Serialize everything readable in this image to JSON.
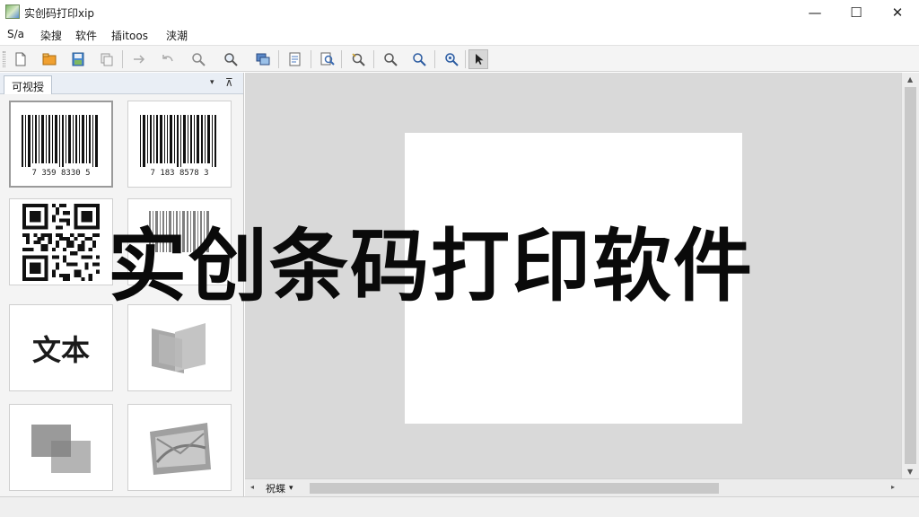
{
  "window": {
    "title": "实创码打印xip",
    "minimize_glyph": "—",
    "maximize_glyph": "☐",
    "close_glyph": "✕"
  },
  "menu": [
    "S/a",
    "染搜",
    "软件",
    "插itoos",
    "浃潮"
  ],
  "toolbar": {
    "buttons": [
      "new-file-icon",
      "open-folder-icon",
      "save-icon",
      "copy-icon",
      "redo-icon",
      "undo-icon",
      "find-icon",
      "zoom-icon",
      "layers-icon",
      "document-icon",
      "search-doc-icon",
      "magic-zoom-icon",
      "zoom-out-icon",
      "zoom-in-icon",
      "zoom-fit-icon",
      "pointer-icon"
    ],
    "active_button": "pointer-icon"
  },
  "left_panel": {
    "tab_label": "可视授",
    "dropdown_glyph": "▾",
    "pin_glyph": "⊼",
    "tiles": [
      {
        "name": "barcode-1",
        "caption": "7 359 8330 5"
      },
      {
        "name": "barcode-2",
        "caption": "7 183 8578 3"
      },
      {
        "name": "qrcode"
      },
      {
        "name": "barcode-3"
      },
      {
        "name": "text",
        "label": "文本"
      },
      {
        "name": "shape-1"
      },
      {
        "name": "shape-2"
      },
      {
        "name": "image"
      }
    ]
  },
  "bottom_bar": {
    "page_tab_label": "祝蝶",
    "page_tab_arrow": "▾",
    "left_arrow": "◂",
    "right_arrow": "▸"
  },
  "overlay": {
    "title": "实创条码打印软件"
  },
  "colors": {
    "canvas_bg": "#d9d9d9",
    "panel_bg": "#f4f4f4",
    "label_bg": "#ffffff",
    "toolbar_bg": "#f4f4f4"
  }
}
